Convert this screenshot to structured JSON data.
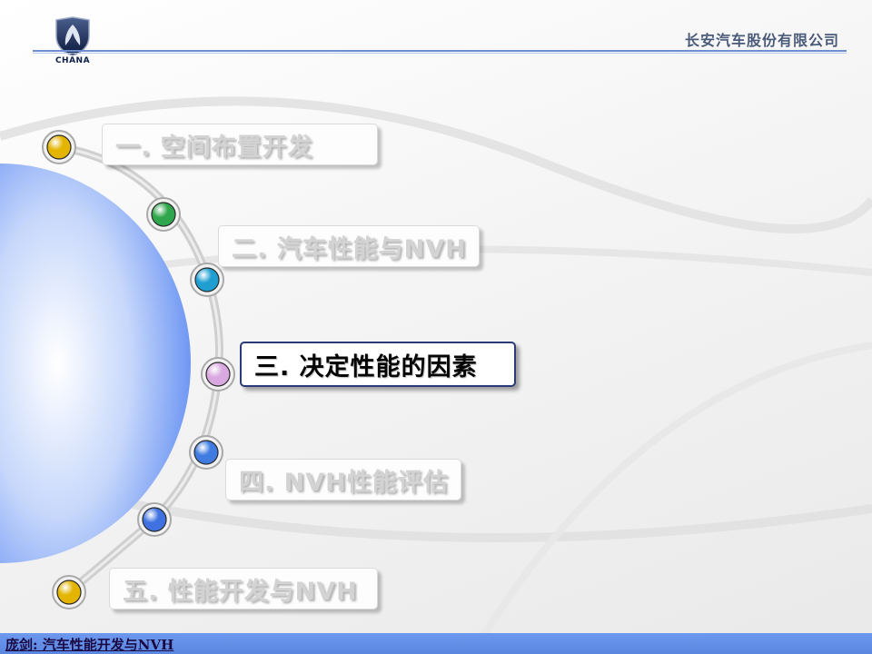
{
  "header": {
    "logo_text": "CHANA",
    "company": "长安汽车股份有限公司"
  },
  "menu": {
    "items": [
      {
        "label": "一.  空间布置开发",
        "active": false
      },
      {
        "label": "二. 汽车性能与NVH",
        "active": false
      },
      {
        "label": "三. 决定性能的因素",
        "active": true
      },
      {
        "label": "四. NVH性能评估",
        "active": false
      },
      {
        "label": "五. 性能开发与NVH",
        "active": false
      }
    ]
  },
  "dots": [
    {
      "color": "#e3b400",
      "name": "yellow"
    },
    {
      "color": "#2fa64c",
      "name": "green"
    },
    {
      "color": "#1f9fd1",
      "name": "teal"
    },
    {
      "color": "#d9a8e0",
      "name": "pink"
    },
    {
      "color": "#3f7be0",
      "name": "blue"
    },
    {
      "color": "#3f72e0",
      "name": "blue"
    },
    {
      "color": "#e3b400",
      "name": "yellow"
    }
  ],
  "colors": {
    "accent": "#5a86e0",
    "active_border": "#2b3a78",
    "inactive_text": "#d3d3d3"
  },
  "footer": {
    "text": "庞剑: 汽车性能开发与NVH"
  }
}
